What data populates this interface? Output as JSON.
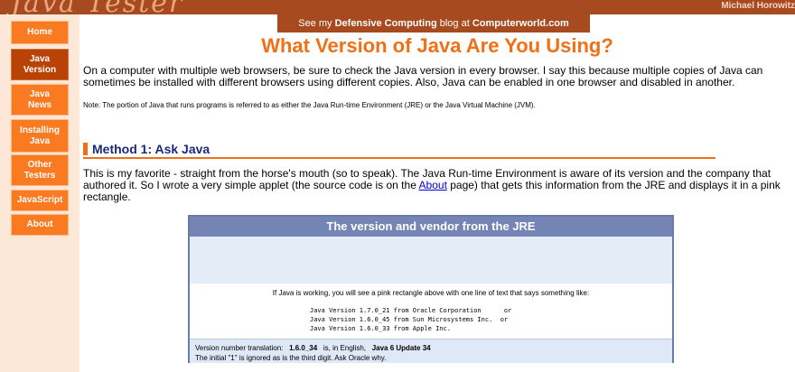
{
  "header": {
    "logo_text": "Java Tester",
    "author": "Michael Horowitz"
  },
  "sidebar": {
    "items": [
      {
        "label_line1": "Home",
        "label_line2": ""
      },
      {
        "label_line1": "Java",
        "label_line2": "Version"
      },
      {
        "label_line1": "Java",
        "label_line2": "News"
      },
      {
        "label_line1": "Installing",
        "label_line2": "Java"
      },
      {
        "label_line1": "Other",
        "label_line2": "Testers"
      },
      {
        "label_line1": "JavaScript",
        "label_line2": ""
      },
      {
        "label_line1": "About",
        "label_line2": ""
      }
    ]
  },
  "blog_banner": {
    "prefix": "See my ",
    "bold1": "Defensive Computing",
    "middle": " blog at ",
    "bold2": "Computerworld.com"
  },
  "main": {
    "title": "What Version of Java Are You Using?",
    "intro": "On a computer with multiple web browsers, be sure to check the Java version in every browser. I say this because multiple copies of Java can sometimes be installed with different browsers using different copies. Also, Java can be enabled in one browser and disabled in another.",
    "note": "Note: The portion of Java that runs programs is referred to as either the Java Run-time Environment (JRE) or the Java Virtual Machine (JVM).",
    "method_heading": "Method 1:  Ask Java",
    "method_text_before": "This is my favorite - straight from the horse's mouth (so to speak). The Java Run-time Environment is aware of its version and the company that authored it. So I wrote a very simple applet (the source code is on the ",
    "method_link": "About",
    "method_text_after": " page) that gets this information from the JRE and displays it in a pink rectangle."
  },
  "jre_box": {
    "header": "The version and vendor from the JRE",
    "instruction": "If Java is working, you will see a pink rectangle above with one line of text that says something like:",
    "examples": [
      "Java Version 1.7.0_21 from Oracle Corporation      or",
      "Java Version 1.6.0_45 from Sun Microsystems Inc.  or",
      "Java Version 1.6.0_33 from Apple Inc."
    ],
    "translation_prefix": "Version number translation:",
    "translation_version": "1.6.0_34",
    "translation_middle": "is, in English,",
    "translation_result": "Java 6 Update 34",
    "translation_note": "The initial \"1\" is ignored as is the third digit. Ask Oracle why."
  }
}
